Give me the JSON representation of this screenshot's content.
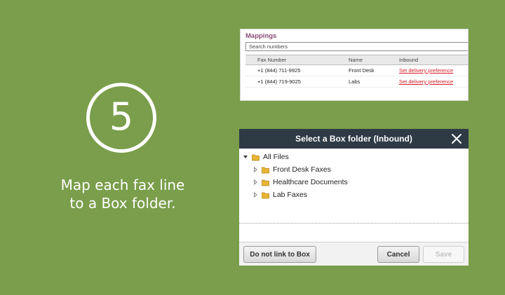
{
  "step": {
    "number": "5",
    "caption_line1": "Map each fax line",
    "caption_line2": "to a Box folder."
  },
  "mappings": {
    "title": "Mappings",
    "search_placeholder": "Search numbers",
    "columns": {
      "fax": "Fax Number",
      "name": "Name",
      "inbound": "Inbound"
    },
    "rows": [
      {
        "fax": "+1 (844) 711-9925",
        "name": "Front Desk",
        "inbound": "Set delivery preference"
      },
      {
        "fax": "+1 (844) 719-9025",
        "name": "Labs",
        "inbound": "Set delivery preference"
      }
    ]
  },
  "dialog": {
    "title": "Select a Box folder (Inbound)",
    "tree": {
      "root": "All Files",
      "children": [
        "Front Desk Faxes",
        "Healthcare Documents",
        "Lab Faxes"
      ]
    },
    "buttons": {
      "no_link": "Do not link to Box",
      "cancel": "Cancel",
      "save": "Save"
    }
  },
  "colors": {
    "background": "#7a9e4b",
    "header": "#2e3a44",
    "title_accent": "#8a4a73",
    "link": "#d81f26",
    "folder": "#e8b634"
  }
}
